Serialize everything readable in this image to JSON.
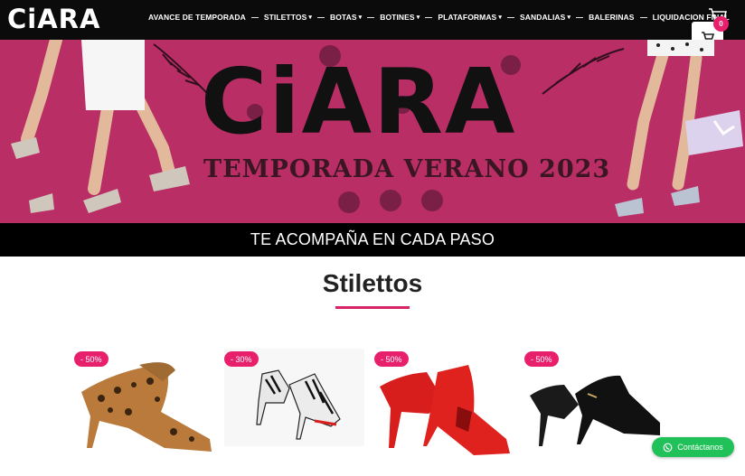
{
  "brand": {
    "logo": "CiARA"
  },
  "nav": {
    "items": [
      {
        "label": "AVANCE DE TEMPORADA",
        "dropdown": false
      },
      {
        "label": "STILETTOS",
        "dropdown": true
      },
      {
        "label": "BOTAS",
        "dropdown": true
      },
      {
        "label": "BOTINES",
        "dropdown": true
      },
      {
        "label": "PLATAFORMAS",
        "dropdown": true
      },
      {
        "label": "SANDALIAS",
        "dropdown": true
      },
      {
        "label": "BALERINAS",
        "dropdown": false
      },
      {
        "label": "LIQUIDACION FINAL",
        "dropdown": false
      }
    ]
  },
  "cart": {
    "count": "0"
  },
  "hero": {
    "logo": "CiARA",
    "subtitle": "TEMPORADA VERANO 2023",
    "tagline": "TE ACOMPAÑA EN CADA PASO"
  },
  "section": {
    "title": "Stilettos"
  },
  "products": [
    {
      "discount": "- 50%",
      "pattern": "leopard"
    },
    {
      "discount": "- 30%",
      "pattern": "zebra"
    },
    {
      "discount": "- 50%",
      "pattern": "red"
    },
    {
      "discount": "- 50%",
      "pattern": "black"
    }
  ],
  "whatsapp": {
    "label": "Contáctanos"
  },
  "colors": {
    "accent": "#e8206c",
    "hero_bg": "#b92e65",
    "whatsapp": "#21c159",
    "topbar": "#0b0b0b"
  }
}
